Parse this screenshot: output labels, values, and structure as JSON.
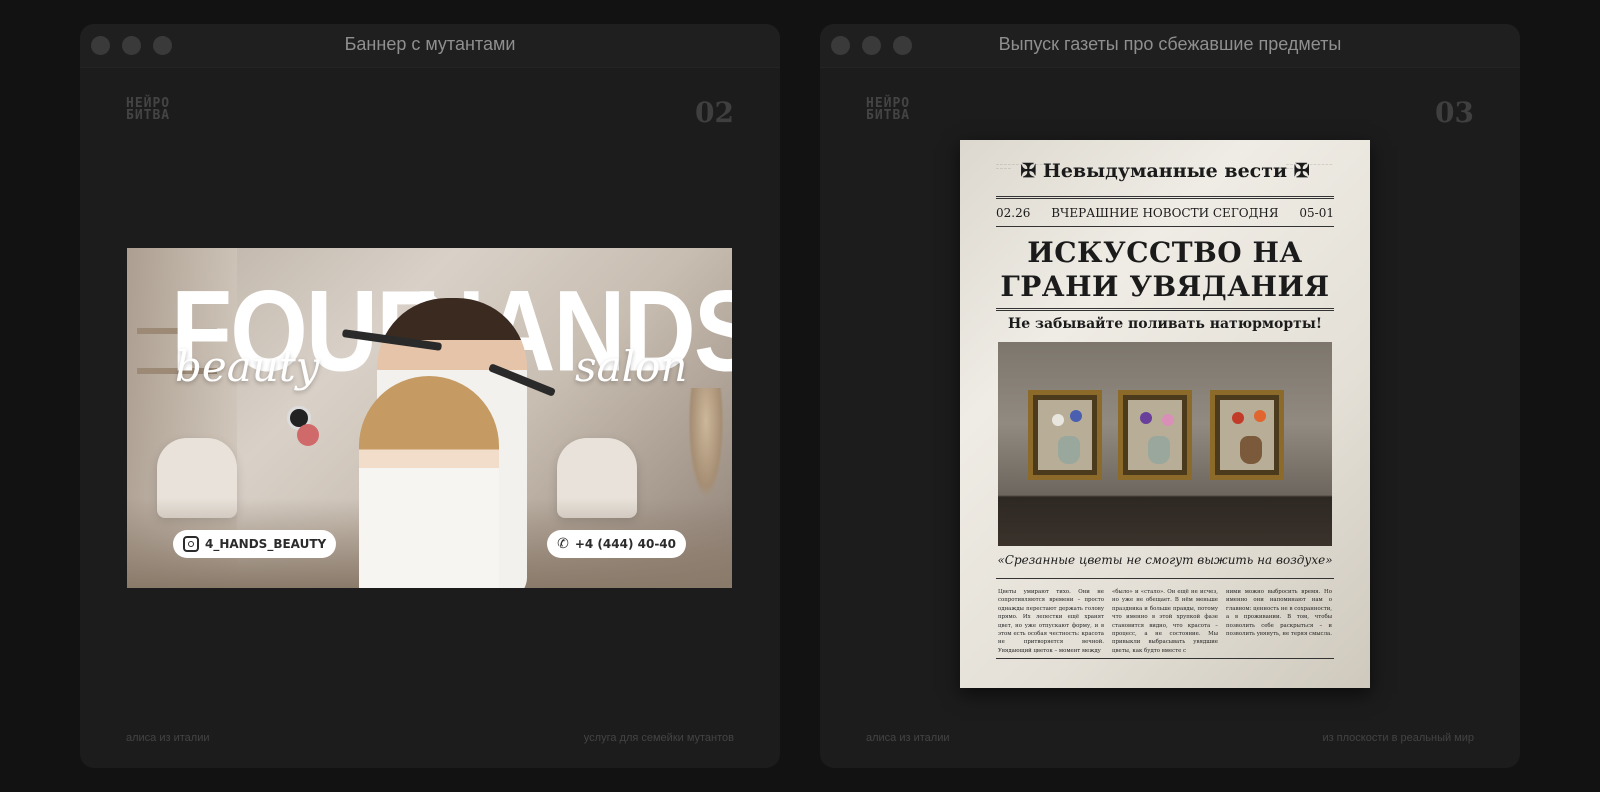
{
  "windows": [
    {
      "title": "Баннер с мутантами",
      "logo": "НЕЙРО\nБИТВА",
      "number": "02",
      "footer_left": "алиса из италии",
      "footer_right": "услуга для семейки мутантов"
    },
    {
      "title": "Выпуск газеты про сбежавшие предметы",
      "logo": "НЕЙРО\nБИТВА",
      "number": "03",
      "footer_left": "алиса из италии",
      "footer_right": "из плоскости в реальный мир"
    }
  ],
  "banner": {
    "word1": "FOUR",
    "word2": "HANDS",
    "script_left": "beauty",
    "script_right": "salon",
    "instagram": "4_HANDS_BEAUTY",
    "phone": "+4 (444) 40-40"
  },
  "newspaper": {
    "masthead": "✠ Невыдуманные вести ✠",
    "date_left": "02.26",
    "date_center": "ВЧЕРАШНИЕ НОВОСТИ СЕГОДНЯ",
    "date_right": "05-01",
    "headline": "ИСКУССТВО НА ГРАНИ УВЯДАНИЯ",
    "subhead": "Не забывайте поливать натюрморты!",
    "caption": "«Срезанные цветы не смогут выжить на воздухе»",
    "col1": "Цветы умирают тихо. Они не сопротивляются времени – просто однажды перестают держать голову прямо. Их лепестки ещё хранят цвет, но уже отпускают форму, и в этом есть особая честность: красота не притворяется вечной. Увядающий цветок – момент между",
    "col2": "«было» и «стало». Он ещё не исчез, но уже не обещает. В нём меньше праздника и больше правды, потому что именно в этой хрупкой фазе становится видно, что красота – процесс, а не состояние. Мы привыкли выбрасывать увядшие цветы, как будто вместе с",
    "col3": "ними можно выбросить время. Но именно они напоминают нам о главном: ценность не в сохранности, а в проживании. В том, чтобы позволить себе раскрыться – и позволить увянуть, не теряя смысла."
  }
}
